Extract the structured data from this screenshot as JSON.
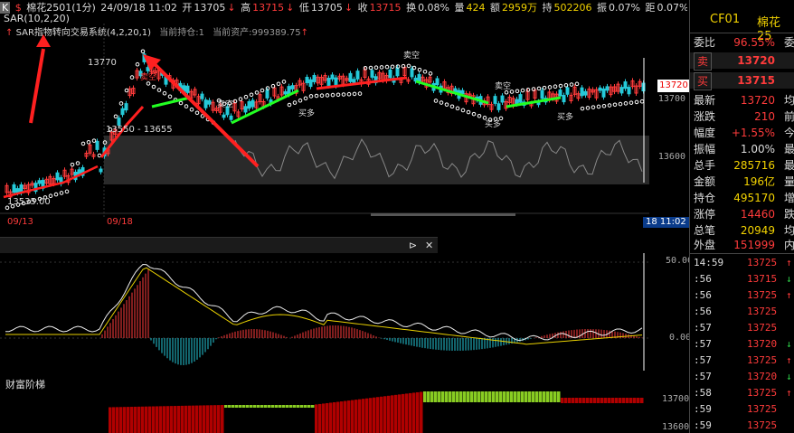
{
  "header": {
    "k_label": "K",
    "dollar_icon": "$",
    "symbol": "棉花2501(1分)",
    "date_time": "24/09/18 11:02",
    "open_label": "开",
    "open": "13705",
    "high_label": "高",
    "high": "13715",
    "low_label": "低",
    "low": "13705",
    "close_label": "收",
    "close": "13715",
    "turnover_label": "换",
    "turnover": "0.08%",
    "volume_label": "量",
    "volume": "424",
    "amount_label": "额",
    "amount": "2959万",
    "hold_label": "持",
    "hold": "502206",
    "amp_label": "振",
    "amp": "0.07%",
    "extra": "距",
    "extra2": "0.07%"
  },
  "indicators": {
    "sar_params": "SAR(10,2,20)",
    "system": "SAR指物转向交易系统(4,2,20,1)",
    "position": "当前持仓:1",
    "assets": "当前资产:999389.75"
  },
  "chart_labels": {
    "peak": "13770",
    "range": "13550 - 13655",
    "buy": "买多",
    "sell": "卖空",
    "start": "13535.00",
    "y_13700": "13700",
    "y_13600": "13600",
    "price_box": "13720",
    "date1": "09/13",
    "date2": "09/18",
    "time_box": "18 11:02",
    "macd_top": "50.00",
    "macd_zero": "0.00",
    "wealth_title": "财富阶梯",
    "wealth_y1": "13700",
    "wealth_y2": "13600"
  },
  "colors": {
    "up": "#ff3b3b",
    "down": "#2fd14a",
    "bg": "#000000",
    "accent": "#0a3b8a"
  },
  "right_panel": {
    "code": "CF01",
    "name": "棉花25",
    "rows": [
      {
        "k": "委比",
        "v": "96.55%",
        "x": "委",
        "color": "#ff3b3b"
      },
      {
        "k": "卖",
        "v": "13720",
        "x": "",
        "color": "#ff3b3b"
      },
      {
        "k": "买",
        "v": "13715",
        "x": "",
        "color": "#ff3b3b"
      },
      {
        "k": "最新",
        "v": "13720",
        "x": "均",
        "color": "#ff3b3b"
      },
      {
        "k": "涨跌",
        "v": "210",
        "x": "前",
        "color": "#ff3b3b"
      },
      {
        "k": "幅度",
        "v": "+1.55%",
        "x": "今",
        "color": "#ff3b3b"
      },
      {
        "k": "振幅",
        "v": "1.00%",
        "x": "最",
        "color": "#dddddd"
      },
      {
        "k": "总手",
        "v": "285716",
        "x": "最",
        "color": "#f2d200"
      },
      {
        "k": "金额",
        "v": "196亿",
        "x": "量",
        "color": "#f2d200"
      },
      {
        "k": "持仓",
        "v": "495170",
        "x": "增",
        "color": "#f2d200"
      },
      {
        "k": "涨停",
        "v": "14460",
        "x": "跌",
        "color": "#ff3b3b"
      },
      {
        "k": "总笔",
        "v": "20949",
        "x": "均",
        "color": "#f2d200"
      },
      {
        "k": "外盘",
        "v": "151999",
        "x": "内",
        "color": "#ff3b3b"
      }
    ],
    "ticks": [
      {
        "t": "14:59",
        "p": "13725",
        "a": "↑",
        "ac": "#ff3b3b"
      },
      {
        "t": ":56",
        "p": "13715",
        "a": "↓",
        "ac": "#2fd14a"
      },
      {
        "t": ":56",
        "p": "13725",
        "a": "↑",
        "ac": "#ff3b3b"
      },
      {
        "t": ":56",
        "p": "13725",
        "a": "",
        "ac": "#ff3b3b"
      },
      {
        "t": ":57",
        "p": "13725",
        "a": "",
        "ac": "#ff3b3b"
      },
      {
        "t": ":57",
        "p": "13720",
        "a": "↓",
        "ac": "#2fd14a"
      },
      {
        "t": ":57",
        "p": "13725",
        "a": "↑",
        "ac": "#ff3b3b"
      },
      {
        "t": ":57",
        "p": "13720",
        "a": "↓",
        "ac": "#2fd14a"
      },
      {
        "t": ":58",
        "p": "13725",
        "a": "↑",
        "ac": "#ff3b3b"
      },
      {
        "t": ":59",
        "p": "13725",
        "a": "",
        "ac": "#ff3b3b"
      },
      {
        "t": ":59",
        "p": "13725",
        "a": "",
        "ac": "#ff3b3b"
      }
    ]
  }
}
